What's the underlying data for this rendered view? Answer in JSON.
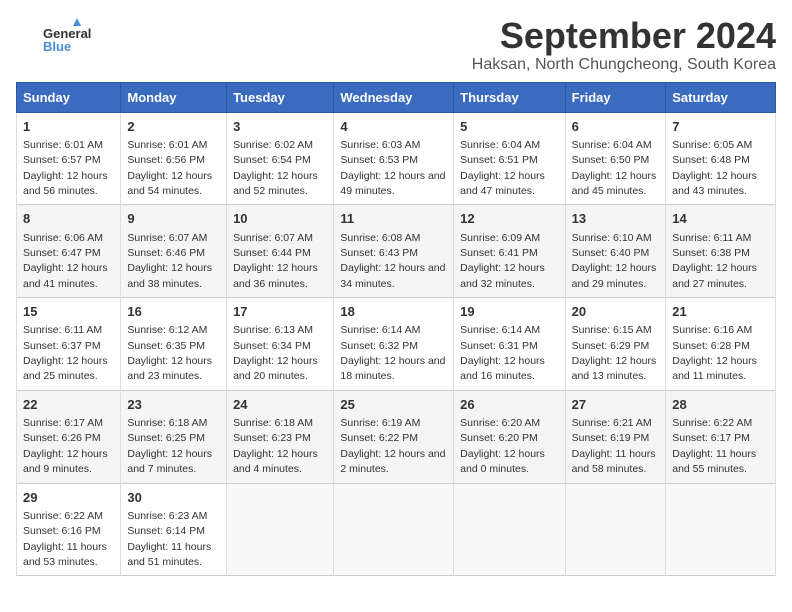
{
  "logo": {
    "general": "General",
    "blue": "Blue"
  },
  "title": "September 2024",
  "location": "Haksan, North Chungcheong, South Korea",
  "headers": [
    "Sunday",
    "Monday",
    "Tuesday",
    "Wednesday",
    "Thursday",
    "Friday",
    "Saturday"
  ],
  "weeks": [
    [
      {
        "day": "1",
        "sunrise": "6:01 AM",
        "sunset": "6:57 PM",
        "daylight": "12 hours and 56 minutes."
      },
      {
        "day": "2",
        "sunrise": "6:01 AM",
        "sunset": "6:56 PM",
        "daylight": "12 hours and 54 minutes."
      },
      {
        "day": "3",
        "sunrise": "6:02 AM",
        "sunset": "6:54 PM",
        "daylight": "12 hours and 52 minutes."
      },
      {
        "day": "4",
        "sunrise": "6:03 AM",
        "sunset": "6:53 PM",
        "daylight": "12 hours and 49 minutes."
      },
      {
        "day": "5",
        "sunrise": "6:04 AM",
        "sunset": "6:51 PM",
        "daylight": "12 hours and 47 minutes."
      },
      {
        "day": "6",
        "sunrise": "6:04 AM",
        "sunset": "6:50 PM",
        "daylight": "12 hours and 45 minutes."
      },
      {
        "day": "7",
        "sunrise": "6:05 AM",
        "sunset": "6:48 PM",
        "daylight": "12 hours and 43 minutes."
      }
    ],
    [
      {
        "day": "8",
        "sunrise": "6:06 AM",
        "sunset": "6:47 PM",
        "daylight": "12 hours and 41 minutes."
      },
      {
        "day": "9",
        "sunrise": "6:07 AM",
        "sunset": "6:46 PM",
        "daylight": "12 hours and 38 minutes."
      },
      {
        "day": "10",
        "sunrise": "6:07 AM",
        "sunset": "6:44 PM",
        "daylight": "12 hours and 36 minutes."
      },
      {
        "day": "11",
        "sunrise": "6:08 AM",
        "sunset": "6:43 PM",
        "daylight": "12 hours and 34 minutes."
      },
      {
        "day": "12",
        "sunrise": "6:09 AM",
        "sunset": "6:41 PM",
        "daylight": "12 hours and 32 minutes."
      },
      {
        "day": "13",
        "sunrise": "6:10 AM",
        "sunset": "6:40 PM",
        "daylight": "12 hours and 29 minutes."
      },
      {
        "day": "14",
        "sunrise": "6:11 AM",
        "sunset": "6:38 PM",
        "daylight": "12 hours and 27 minutes."
      }
    ],
    [
      {
        "day": "15",
        "sunrise": "6:11 AM",
        "sunset": "6:37 PM",
        "daylight": "12 hours and 25 minutes."
      },
      {
        "day": "16",
        "sunrise": "6:12 AM",
        "sunset": "6:35 PM",
        "daylight": "12 hours and 23 minutes."
      },
      {
        "day": "17",
        "sunrise": "6:13 AM",
        "sunset": "6:34 PM",
        "daylight": "12 hours and 20 minutes."
      },
      {
        "day": "18",
        "sunrise": "6:14 AM",
        "sunset": "6:32 PM",
        "daylight": "12 hours and 18 minutes."
      },
      {
        "day": "19",
        "sunrise": "6:14 AM",
        "sunset": "6:31 PM",
        "daylight": "12 hours and 16 minutes."
      },
      {
        "day": "20",
        "sunrise": "6:15 AM",
        "sunset": "6:29 PM",
        "daylight": "12 hours and 13 minutes."
      },
      {
        "day": "21",
        "sunrise": "6:16 AM",
        "sunset": "6:28 PM",
        "daylight": "12 hours and 11 minutes."
      }
    ],
    [
      {
        "day": "22",
        "sunrise": "6:17 AM",
        "sunset": "6:26 PM",
        "daylight": "12 hours and 9 minutes."
      },
      {
        "day": "23",
        "sunrise": "6:18 AM",
        "sunset": "6:25 PM",
        "daylight": "12 hours and 7 minutes."
      },
      {
        "day": "24",
        "sunrise": "6:18 AM",
        "sunset": "6:23 PM",
        "daylight": "12 hours and 4 minutes."
      },
      {
        "day": "25",
        "sunrise": "6:19 AM",
        "sunset": "6:22 PM",
        "daylight": "12 hours and 2 minutes."
      },
      {
        "day": "26",
        "sunrise": "6:20 AM",
        "sunset": "6:20 PM",
        "daylight": "12 hours and 0 minutes."
      },
      {
        "day": "27",
        "sunrise": "6:21 AM",
        "sunset": "6:19 PM",
        "daylight": "11 hours and 58 minutes."
      },
      {
        "day": "28",
        "sunrise": "6:22 AM",
        "sunset": "6:17 PM",
        "daylight": "11 hours and 55 minutes."
      }
    ],
    [
      {
        "day": "29",
        "sunrise": "6:22 AM",
        "sunset": "6:16 PM",
        "daylight": "11 hours and 53 minutes."
      },
      {
        "day": "30",
        "sunrise": "6:23 AM",
        "sunset": "6:14 PM",
        "daylight": "11 hours and 51 minutes."
      },
      null,
      null,
      null,
      null,
      null
    ]
  ]
}
